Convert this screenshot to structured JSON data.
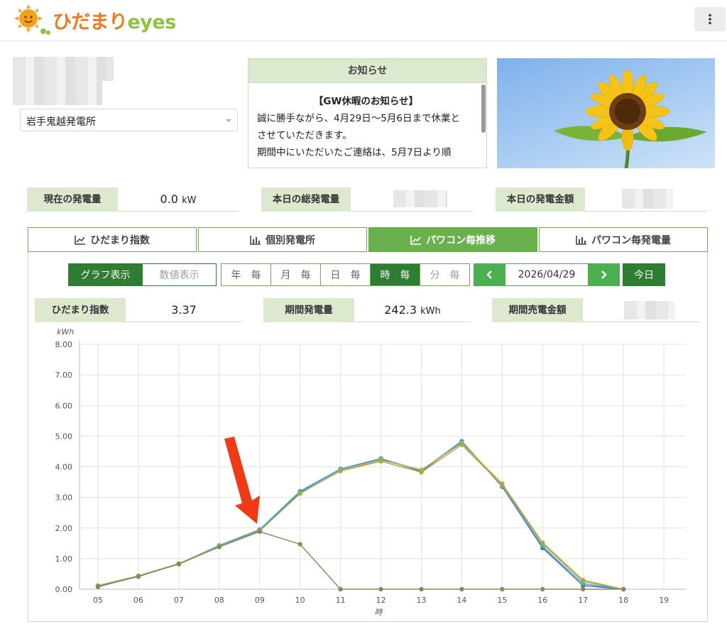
{
  "app": {
    "logo_jp": "ひだまり",
    "logo_en": "eyes"
  },
  "plant_select": {
    "value": "岩手鬼越発電所"
  },
  "notice": {
    "title": "お知らせ",
    "heading": "【GW休暇のお知らせ】",
    "lines": [
      "誠に勝手ながら、4月29日～5月6日まで休業と",
      "させていただきます。",
      "期間中にいただいたご連絡は、5月7日より順"
    ]
  },
  "stats": {
    "current_power_label": "現在の発電量",
    "current_power_value": "0.0",
    "current_power_unit": "kW",
    "today_total_label": "本日の総発電量",
    "today_amount_label": "本日の発電金額"
  },
  "tabs": [
    {
      "label": "ひだまり指数",
      "icon": "line-chart-icon"
    },
    {
      "label": "個別発電所",
      "icon": "bar-chart-icon"
    },
    {
      "label": "パワコン毎推移",
      "icon": "line-chart-icon"
    },
    {
      "label": "パワコン毎発電量",
      "icon": "bar-chart-icon"
    }
  ],
  "view_mode": {
    "graph": "グラフ表示",
    "number": "数値表示"
  },
  "periods": [
    "年　毎",
    "月　毎",
    "日　毎",
    "時　毎",
    "分　毎"
  ],
  "date": "2026/04/29",
  "today_label": "今日",
  "period_stats": {
    "index_label": "ひだまり指数",
    "index_value": "3.37",
    "energy_label": "期間発電量",
    "energy_value": "242.3",
    "energy_unit": "kWh",
    "sales_label": "期間売電金額"
  },
  "colors": {
    "accent": "#6ab04c",
    "dark_green": "#2e7d32",
    "label_bg": "#dce9cf",
    "arrow": "#f03a14"
  },
  "chart_data": {
    "type": "line",
    "ylabel": "kWh",
    "xlabel": "時",
    "ylim": [
      0,
      8
    ],
    "yticks": [
      "0.00",
      "1.00",
      "2.00",
      "3.00",
      "4.00",
      "5.00",
      "6.00",
      "7.00",
      "8.00"
    ],
    "x": [
      "05",
      "06",
      "07",
      "08",
      "09",
      "10",
      "11",
      "12",
      "13",
      "14",
      "15",
      "16",
      "17",
      "18",
      "19"
    ],
    "grid": true,
    "series": [
      {
        "color": "#4a5cc7",
        "values": [
          0.08,
          0.42,
          0.82,
          1.42,
          1.94,
          3.18,
          3.92,
          4.26,
          3.85,
          4.82,
          3.35,
          1.35,
          0.12,
          0.0,
          null
        ]
      },
      {
        "color": "#3aa8d8",
        "values": [
          0.1,
          0.41,
          0.83,
          1.43,
          1.95,
          3.2,
          3.93,
          4.27,
          3.87,
          4.84,
          3.37,
          1.4,
          0.18,
          0.0,
          null
        ]
      },
      {
        "color": "#d9a23a",
        "values": [
          0.12,
          0.44,
          0.84,
          1.4,
          1.91,
          3.12,
          3.88,
          4.22,
          3.9,
          4.77,
          3.45,
          1.52,
          0.3,
          0.0,
          null
        ]
      },
      {
        "color": "#96b04a",
        "values": [
          0.11,
          0.43,
          0.83,
          1.39,
          1.9,
          3.14,
          3.86,
          4.18,
          3.82,
          4.72,
          3.4,
          1.48,
          0.25,
          0.0,
          null
        ]
      },
      {
        "color": "#8a8a58",
        "values": [
          0.09,
          0.42,
          0.82,
          1.38,
          1.88,
          1.47,
          0.0,
          0.0,
          0.0,
          0.0,
          0.0,
          0.0,
          0.0,
          0.0,
          null
        ]
      }
    ]
  }
}
